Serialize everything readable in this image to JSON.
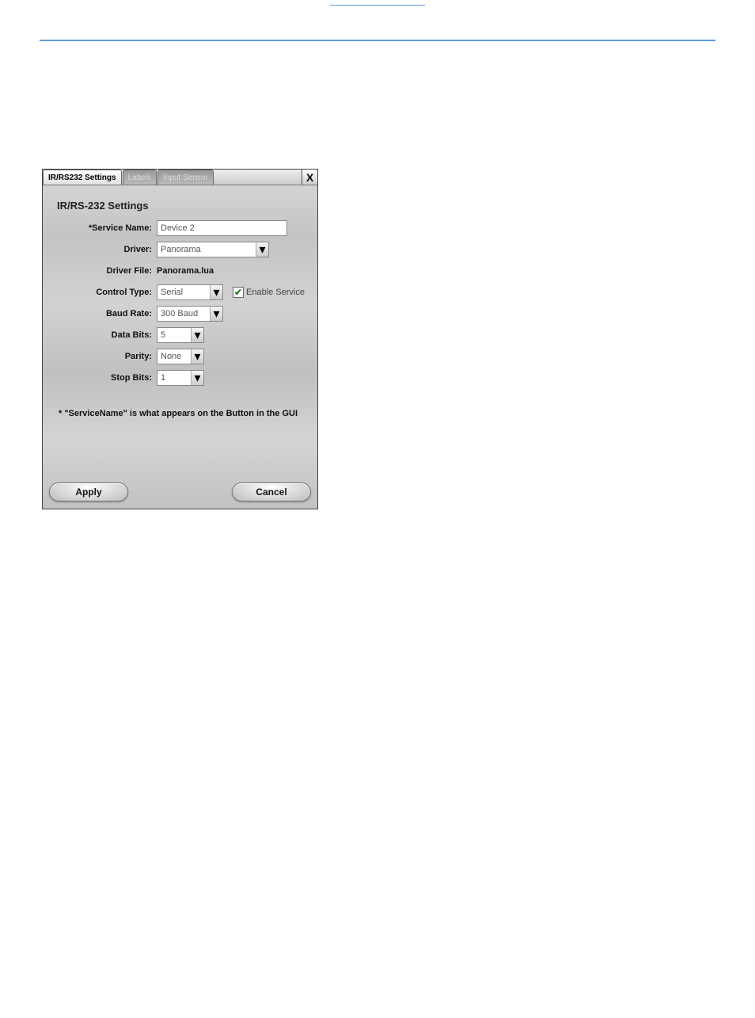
{
  "tabs": {
    "active": "IR/RS232 Settings",
    "labels": "Labels",
    "input_sensor": "Input Sensor"
  },
  "close_glyph": "X",
  "panel_title": "IR/RS-232 Settings",
  "rows": {
    "service_name": {
      "label": "*Service Name:",
      "value": "Device 2"
    },
    "driver": {
      "label": "Driver:",
      "value": "Panorama"
    },
    "driver_file": {
      "label": "Driver File:",
      "value": "Panorama.lua"
    },
    "control_type": {
      "label": "Control Type:",
      "value": "Serial"
    },
    "baud_rate": {
      "label": "Baud Rate:",
      "value": "300 Baud"
    },
    "data_bits": {
      "label": "Data Bits:",
      "value": "5"
    },
    "parity": {
      "label": "Parity:",
      "value": "None"
    },
    "stop_bits": {
      "label": "Stop Bits:",
      "value": "1"
    }
  },
  "enable_service": {
    "label": "Enable Service",
    "check_glyph": "✔"
  },
  "hint": "* \"ServiceName\" is what appears on the Button in the GUI",
  "buttons": {
    "apply": "Apply",
    "cancel": "Cancel"
  },
  "chevron_glyph": "▾"
}
